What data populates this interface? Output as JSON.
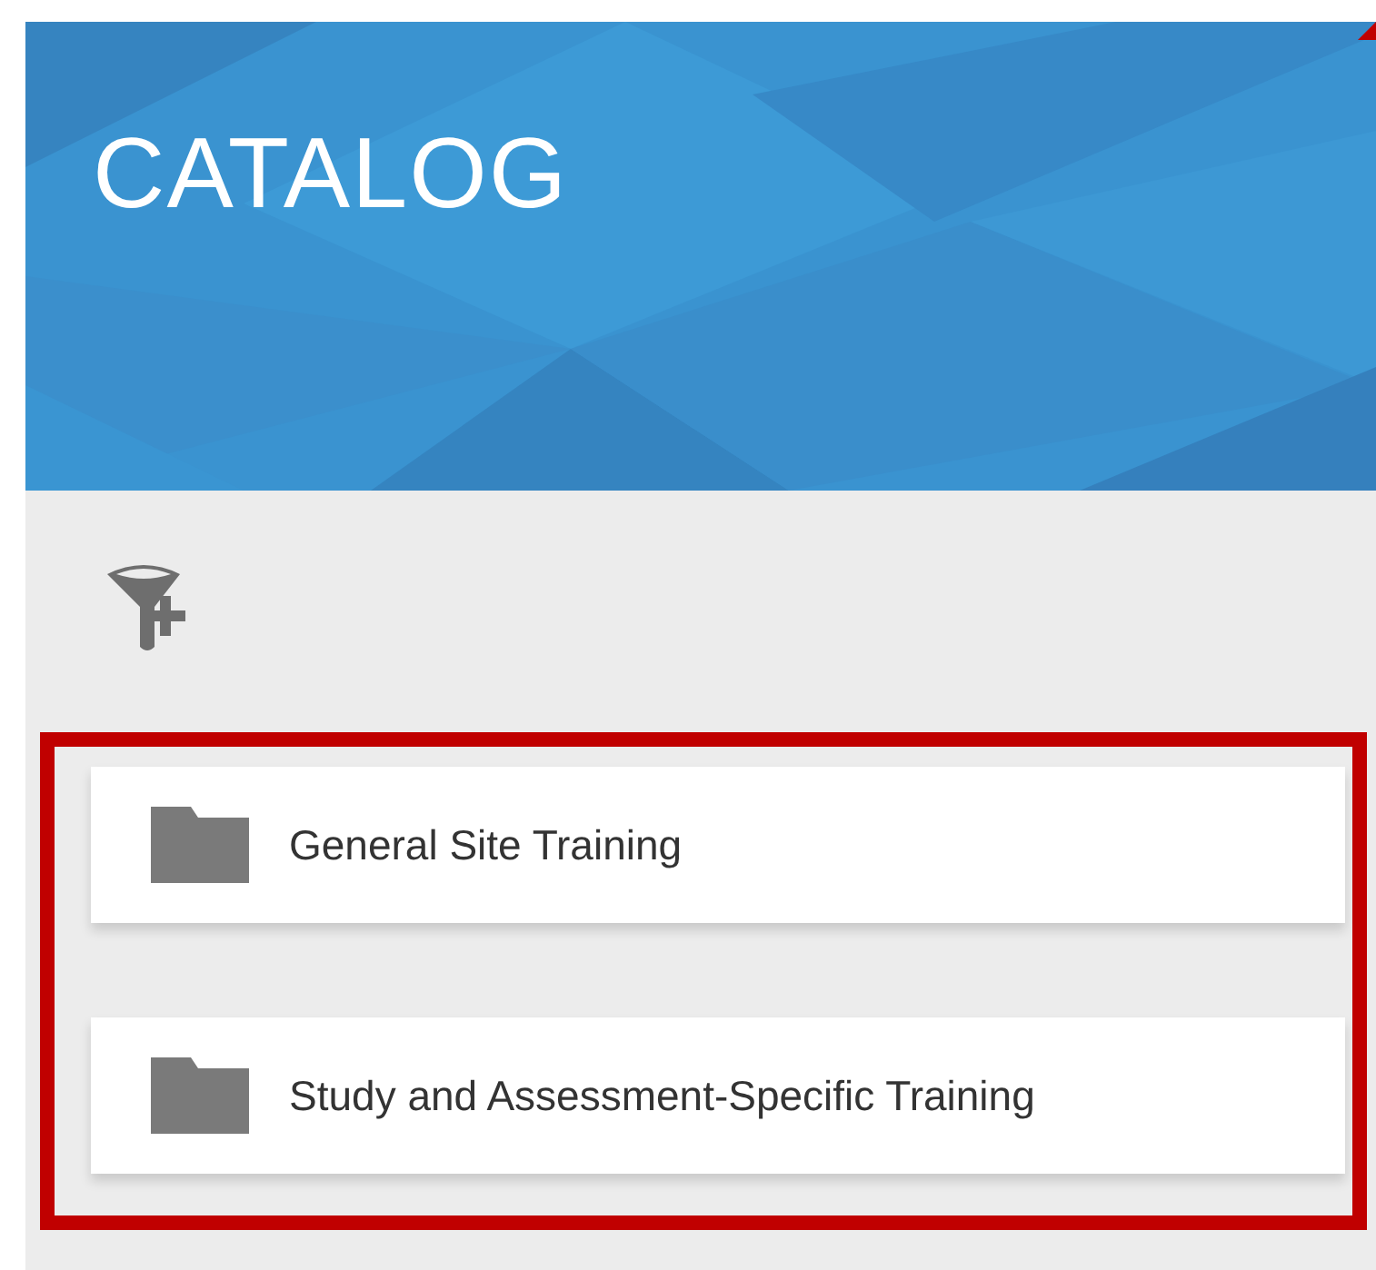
{
  "header": {
    "title": "CATALOG"
  },
  "folders": [
    {
      "label": "General Site Training"
    },
    {
      "label": "Study and Assessment-Specific Training"
    }
  ]
}
